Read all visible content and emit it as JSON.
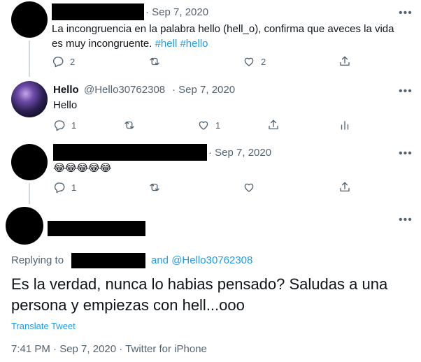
{
  "tweet1": {
    "date": "· Sep 7, 2020",
    "text": "La incongruencia en la palabra hello (hell_o), confirma que aveces la vida es muy incongruente.",
    "hashtags": [
      "#hell",
      "#hello"
    ],
    "reply_count": "2",
    "like_count": "2"
  },
  "tweet2": {
    "name": "Hello",
    "handle": "@Hello30762308",
    "date": "· Sep 7, 2020",
    "text": "Hello",
    "reply_count": "1",
    "like_count": "1"
  },
  "tweet3": {
    "date": "· Sep 7, 2020",
    "text": "😂😂😂😂😂",
    "reply_count": "1"
  },
  "main": {
    "replying_to": "Replying to",
    "and_mention": "and @Hello30762308",
    "text": "Es la verdad, nunca lo habias pensado? Saludas a una persona y empiezas con hell...ooo",
    "translate": "Translate Tweet",
    "timestamp": "7:41 PM · Sep 7, 2020 · Twitter for iPhone"
  },
  "more_glyph": "•••",
  "colors": {
    "link": "#1d9bf0",
    "muted": "#536471",
    "thread_line": "#cfd9de"
  },
  "icons": [
    "reply-icon",
    "retweet-icon",
    "like-icon",
    "share-icon",
    "analytics-icon",
    "more-icon"
  ]
}
